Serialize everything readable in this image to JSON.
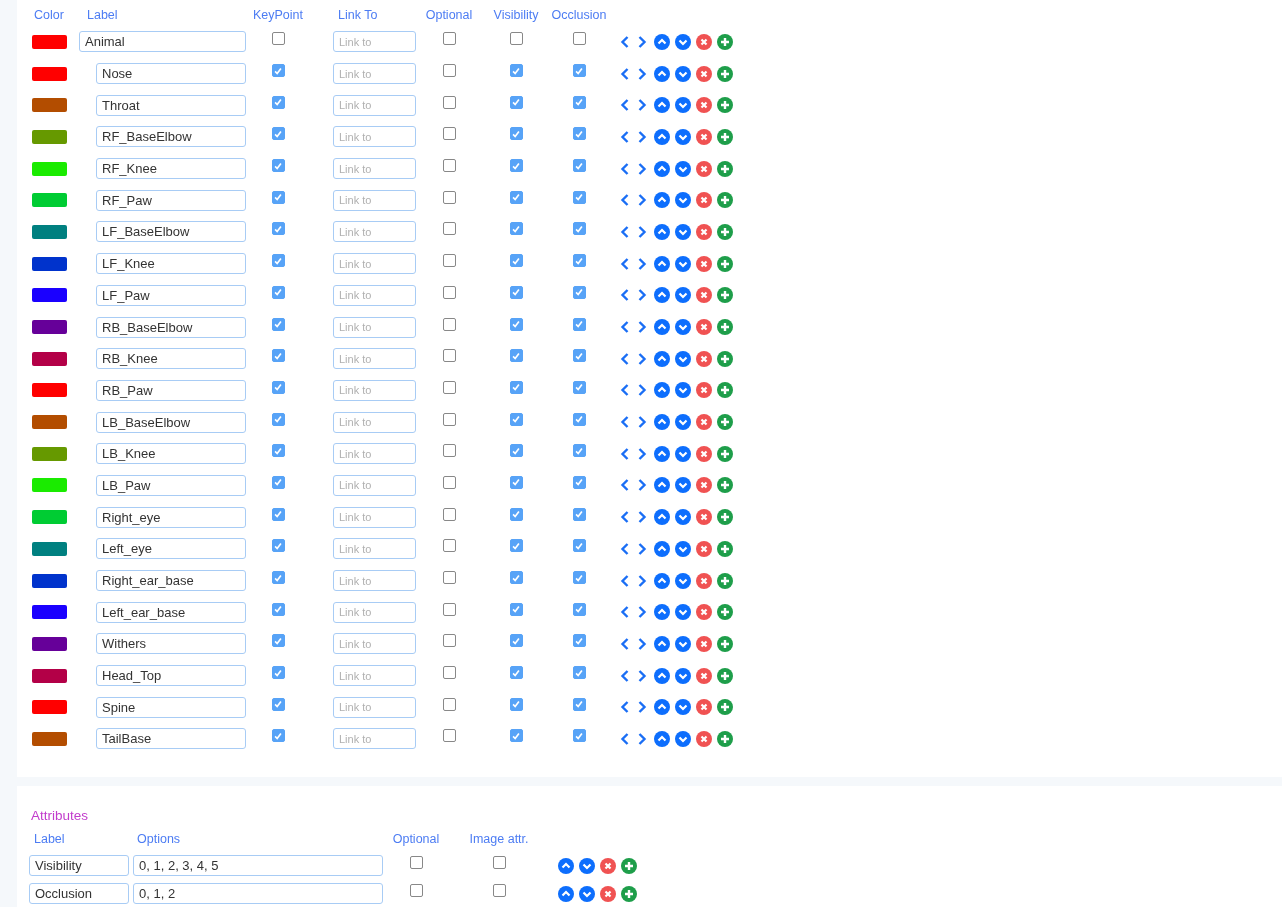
{
  "skeleton": {
    "columns": [
      "Color",
      "Label",
      "KeyPoint",
      "Link To",
      "Optional",
      "Visibility",
      "Occlusion"
    ],
    "nodes": [
      {
        "label": "Animal",
        "color": "#ff0000",
        "keypoint": false,
        "link_placeholder": "Link to",
        "optional": false,
        "visibility": false,
        "occlusion": false,
        "children": [
          {
            "label": "Nose",
            "color": "#ff0000",
            "keypoint": true,
            "link_placeholder": "Link to",
            "optional": false,
            "visibility": true,
            "occlusion": true
          },
          {
            "label": "Throat",
            "color": "#b34d00",
            "keypoint": true,
            "link_placeholder": "Link to",
            "optional": false,
            "visibility": true,
            "occlusion": true
          },
          {
            "label": "RF_BaseElbow",
            "color": "#669900",
            "keypoint": true,
            "link_placeholder": "Link to",
            "optional": false,
            "visibility": true,
            "occlusion": true
          },
          {
            "label": "RF_Knee",
            "color": "#1aeb00",
            "keypoint": true,
            "link_placeholder": "Link to",
            "optional": false,
            "visibility": true,
            "occlusion": true
          },
          {
            "label": "RF_Paw",
            "color": "#00cc33",
            "keypoint": true,
            "link_placeholder": "Link to",
            "optional": false,
            "visibility": true,
            "occlusion": true
          },
          {
            "label": "LF_BaseElbow",
            "color": "#008080",
            "keypoint": true,
            "link_placeholder": "Link to",
            "optional": false,
            "visibility": true,
            "occlusion": true
          },
          {
            "label": "LF_Knee",
            "color": "#0033cc",
            "keypoint": true,
            "link_placeholder": "Link to",
            "optional": false,
            "visibility": true,
            "occlusion": true
          },
          {
            "label": "LF_Paw",
            "color": "#1a00ff",
            "keypoint": true,
            "link_placeholder": "Link to",
            "optional": false,
            "visibility": true,
            "occlusion": true
          },
          {
            "label": "RB_BaseElbow",
            "color": "#660099",
            "keypoint": true,
            "link_placeholder": "Link to",
            "optional": false,
            "visibility": true,
            "occlusion": true
          },
          {
            "label": "RB_Knee",
            "color": "#b30047",
            "keypoint": true,
            "link_placeholder": "Link to",
            "optional": false,
            "visibility": true,
            "occlusion": true
          },
          {
            "label": "RB_Paw",
            "color": "#ff0000",
            "keypoint": true,
            "link_placeholder": "Link to",
            "optional": false,
            "visibility": true,
            "occlusion": true
          },
          {
            "label": "LB_BaseElbow",
            "color": "#b34d00",
            "keypoint": true,
            "link_placeholder": "Link to",
            "optional": false,
            "visibility": true,
            "occlusion": true
          },
          {
            "label": "LB_Knee",
            "color": "#669900",
            "keypoint": true,
            "link_placeholder": "Link to",
            "optional": false,
            "visibility": true,
            "occlusion": true
          },
          {
            "label": "LB_Paw",
            "color": "#1aeb00",
            "keypoint": true,
            "link_placeholder": "Link to",
            "optional": false,
            "visibility": true,
            "occlusion": true
          },
          {
            "label": "Right_eye",
            "color": "#00cc33",
            "keypoint": true,
            "link_placeholder": "Link to",
            "optional": false,
            "visibility": true,
            "occlusion": true
          },
          {
            "label": "Left_eye",
            "color": "#008080",
            "keypoint": true,
            "link_placeholder": "Link to",
            "optional": false,
            "visibility": true,
            "occlusion": true
          },
          {
            "label": "Right_ear_base",
            "color": "#0033cc",
            "keypoint": true,
            "link_placeholder": "Link to",
            "optional": false,
            "visibility": true,
            "occlusion": true
          },
          {
            "label": "Left_ear_base",
            "color": "#1a00ff",
            "keypoint": true,
            "link_placeholder": "Link to",
            "optional": false,
            "visibility": true,
            "occlusion": true
          },
          {
            "label": "Withers",
            "color": "#660099",
            "keypoint": true,
            "link_placeholder": "Link to",
            "optional": false,
            "visibility": true,
            "occlusion": true
          },
          {
            "label": "Head_Top",
            "color": "#b30047",
            "keypoint": true,
            "link_placeholder": "Link to",
            "optional": false,
            "visibility": true,
            "occlusion": true
          },
          {
            "label": "Spine",
            "color": "#ff0000",
            "keypoint": true,
            "link_placeholder": "Link to",
            "optional": false,
            "visibility": true,
            "occlusion": true
          },
          {
            "label": "TailBase",
            "color": "#b34d00",
            "keypoint": true,
            "link_placeholder": "Link to",
            "optional": false,
            "visibility": true,
            "occlusion": true
          }
        ]
      }
    ]
  },
  "attributes": {
    "title": "Attributes",
    "columns": [
      "Label",
      "Options",
      "Optional",
      "Image attr."
    ],
    "rows": [
      {
        "label": "Visibility",
        "options": "0, 1, 2, 3, 4, 5",
        "optional": false,
        "image_attr": false
      },
      {
        "label": "Occlusion",
        "options": "0, 1, 2",
        "optional": false,
        "image_attr": false
      }
    ]
  }
}
